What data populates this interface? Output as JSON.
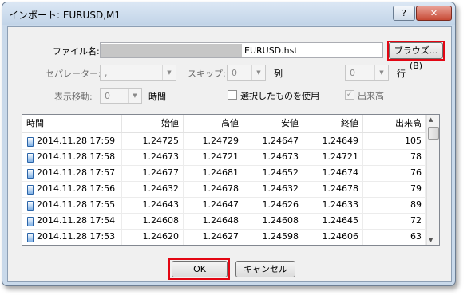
{
  "window": {
    "title": "インポート: EURUSD,M1",
    "help_label": "?",
    "close_label": "✕"
  },
  "file": {
    "label": "ファイル名:",
    "value": "EURUSD.hst",
    "browse_label": "ブラウズ... (B)"
  },
  "separator": {
    "label": "セパレーター:",
    "value": ","
  },
  "skip": {
    "label": "スキップ:",
    "cols_value": "0",
    "cols_unit": "列",
    "rows_value": "0",
    "rows_unit": "行"
  },
  "move": {
    "label": "表示移動:",
    "value": "0",
    "unit": "時間"
  },
  "use_selected": {
    "label": "選択したものを使用",
    "checked": false
  },
  "volume": {
    "label": "出来高",
    "checked": true,
    "enabled": false
  },
  "table": {
    "columns": [
      "時間",
      "始値",
      "高値",
      "安値",
      "終値",
      "出来高"
    ],
    "rows": [
      [
        "2014.11.28 17:59",
        "1.24725",
        "1.24729",
        "1.24647",
        "1.24649",
        "105"
      ],
      [
        "2014.11.28 17:58",
        "1.24673",
        "1.24721",
        "1.24673",
        "1.24721",
        "78"
      ],
      [
        "2014.11.28 17:57",
        "1.24677",
        "1.24681",
        "1.24652",
        "1.24674",
        "76"
      ],
      [
        "2014.11.28 17:56",
        "1.24632",
        "1.24678",
        "1.24632",
        "1.24678",
        "79"
      ],
      [
        "2014.11.28 17:55",
        "1.24643",
        "1.24647",
        "1.24626",
        "1.24633",
        "89"
      ],
      [
        "2014.11.28 17:54",
        "1.24608",
        "1.24648",
        "1.24608",
        "1.24645",
        "72"
      ],
      [
        "2014.11.28 17:53",
        "1.24620",
        "1.24627",
        "1.24598",
        "1.24606",
        "63"
      ]
    ]
  },
  "buttons": {
    "ok": "OK",
    "cancel": "キャンセル"
  },
  "colors": {
    "highlight": "#e30613",
    "dialog_bg": "#c9d9ea"
  }
}
